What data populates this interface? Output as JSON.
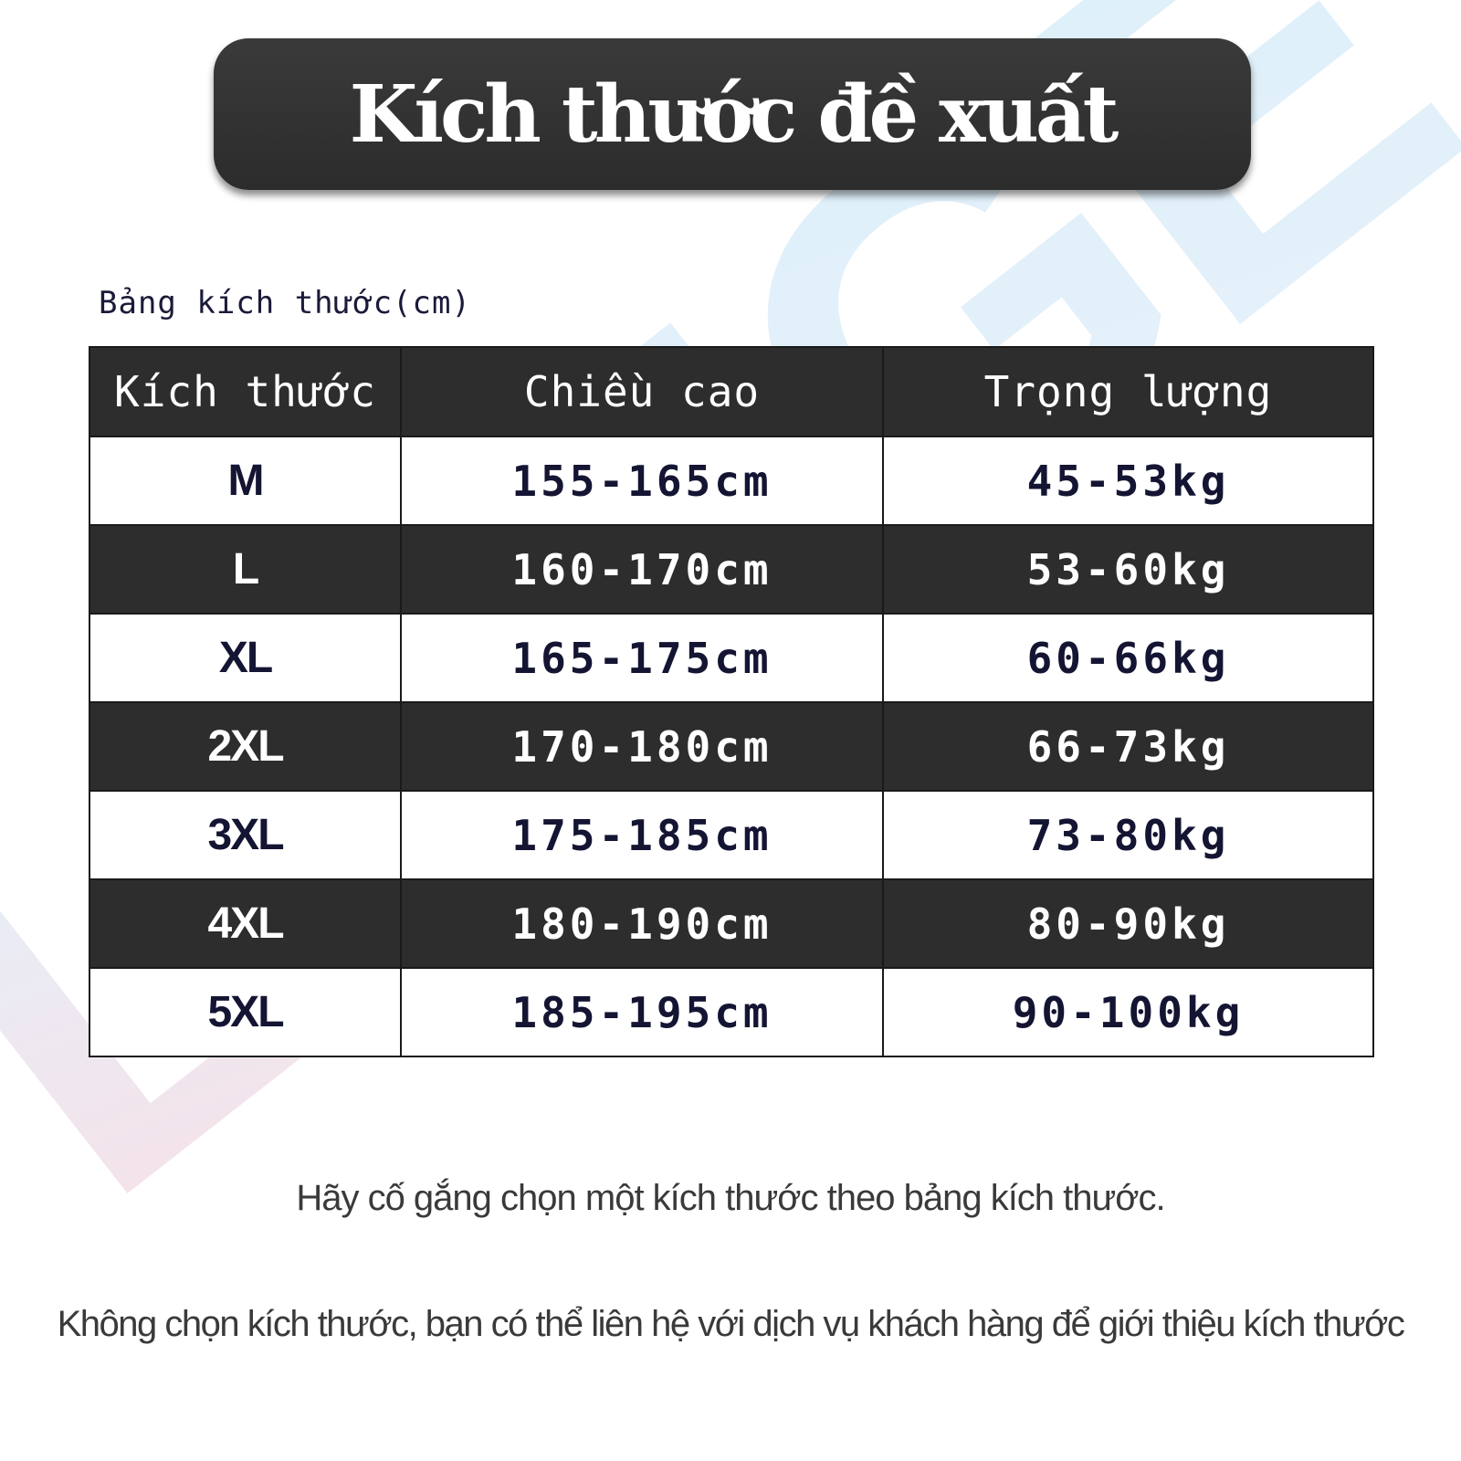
{
  "title": "Kích thước đề xuất",
  "table_caption": "Bảng kích thước(cm)",
  "table": {
    "headers": [
      "Kích thước",
      "Chiều cao",
      "Trọng lượng"
    ],
    "rows": [
      {
        "size": "M",
        "height": "155-165cm",
        "weight": "45-53kg"
      },
      {
        "size": "L",
        "height": "160-170cm",
        "weight": "53-60kg"
      },
      {
        "size": "XL",
        "height": "165-175cm",
        "weight": "60-66kg"
      },
      {
        "size": "2XL",
        "height": "170-180cm",
        "weight": "66-73kg"
      },
      {
        "size": "3XL",
        "height": "175-185cm",
        "weight": "73-80kg"
      },
      {
        "size": "4XL",
        "height": "180-190cm",
        "weight": "80-90kg"
      },
      {
        "size": "5XL",
        "height": "185-195cm",
        "weight": "90-100kg"
      }
    ]
  },
  "notes": [
    "Hãy cố gắng chọn một kích thước theo bảng kích thước.",
    "Không chọn kích thước, bạn có thể liên hệ với dịch vụ khách hàng để giới thiệu kích thước"
  ],
  "watermark": {
    "text": "LANGE",
    "colors": [
      "#f4c6d2",
      "#cfe4f6",
      "#bfe6f5"
    ]
  },
  "colors": {
    "dark_row": "#2d2d2d",
    "light_row": "#ffffff",
    "dark_text": "#141433",
    "note_text": "#3a3a3a"
  }
}
